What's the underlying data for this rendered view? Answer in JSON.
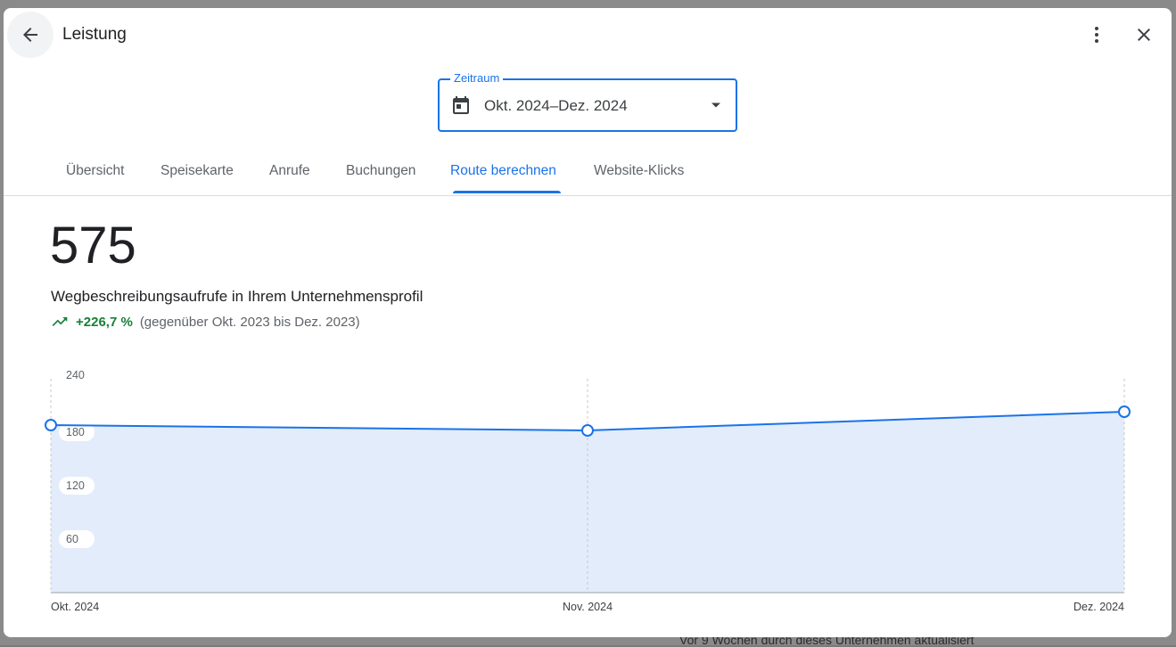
{
  "header": {
    "title": "Leistung"
  },
  "date_range": {
    "label": "Zeitraum",
    "value": "Okt. 2024–Dez. 2024"
  },
  "tabs": [
    {
      "label": "Übersicht"
    },
    {
      "label": "Speisekarte"
    },
    {
      "label": "Anrufe"
    },
    {
      "label": "Buchungen"
    },
    {
      "label": "Route berechnen",
      "active": true
    },
    {
      "label": "Website-Klicks"
    }
  ],
  "metric": {
    "value": "575",
    "description": "Wegbeschreibungsaufrufe in Ihrem Unternehmensprofil",
    "change": "+226,7 %",
    "comparison": "(gegenüber Okt. 2023 bis Dez. 2023)"
  },
  "background": {
    "snippet": "Vor 9 Wochen durch dieses Unternehmen aktualisiert"
  },
  "colors": {
    "accent": "#1a73e8",
    "trend_positive": "#188038",
    "area_fill": "#e3ecfb"
  },
  "chart_data": {
    "type": "area",
    "categories": [
      "Okt. 2024",
      "Nov. 2024",
      "Dez. 2024"
    ],
    "values": [
      188,
      182,
      203
    ],
    "ylim": [
      0,
      240
    ],
    "yticks": [
      60,
      120,
      180,
      240
    ],
    "grid": "vertical-dashed"
  }
}
